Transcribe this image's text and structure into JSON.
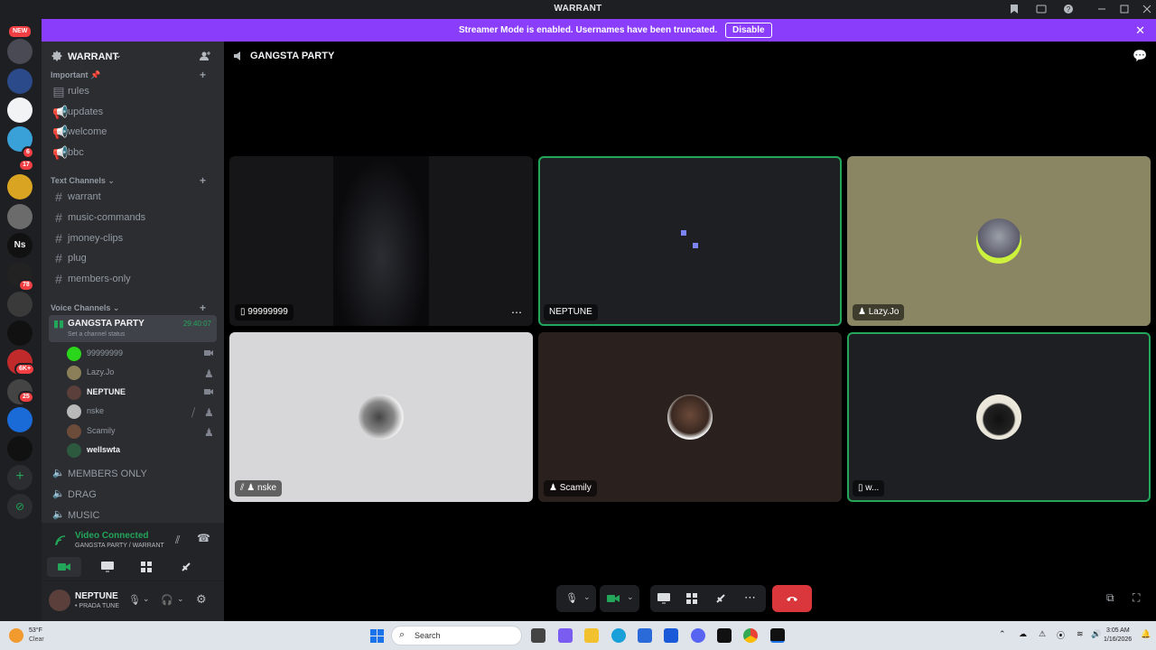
{
  "window": {
    "title": "WARRANT"
  },
  "banner": {
    "message": "Streamer Mode is enabled. Usernames have been truncated.",
    "button": "Disable"
  },
  "rail": {
    "new_badge": "NEW",
    "badges": [
      "6",
      "17",
      "78",
      "6K+",
      "25"
    ],
    "ns_label": "Ns"
  },
  "server": {
    "name": "WARRANT"
  },
  "sidebar": {
    "categories": {
      "important": "Important",
      "text": "Text Channels",
      "voice": "Voice Channels"
    },
    "announcements": [
      {
        "label": "rules"
      },
      {
        "label": "updates"
      },
      {
        "label": "welcome"
      },
      {
        "label": "bbc"
      }
    ],
    "text_channels": [
      {
        "label": "warrant"
      },
      {
        "label": "music-commands"
      },
      {
        "label": "jmoney-clips"
      },
      {
        "label": "plug"
      },
      {
        "label": "members-only"
      }
    ],
    "voice_channel": {
      "label": "GANGSTA PARTY",
      "timer": "29:40:07",
      "status": "Set a channel status"
    },
    "voice_users": [
      {
        "name": "99999999",
        "icon": "camera-icon",
        "color": "#2bd61a"
      },
      {
        "name": "Lazy.Jo",
        "icon": "playstation-icon",
        "color": "#8a7f58"
      },
      {
        "name": "NEPTUNE",
        "icon": "camera-icon",
        "color": "#5a3f3a"
      },
      {
        "name": "nske",
        "icon": "playstation-icon",
        "color": "#b9b9b9"
      },
      {
        "name": "Scamily",
        "icon": "playstation-icon",
        "color": "#6b4b3a"
      },
      {
        "name": "wellswta",
        "icon": "",
        "color": "#2d5a3f"
      }
    ],
    "more_voice": [
      {
        "label": "MEMBERS ONLY"
      },
      {
        "label": "DRAG"
      },
      {
        "label": "MUSIC"
      }
    ]
  },
  "voice_panel": {
    "status": "Video Connected",
    "location": "GANGSTA PARTY / WARRANT"
  },
  "user_panel": {
    "name": "NEPTUNE",
    "status": "• PRADA TUNE"
  },
  "call": {
    "channel": "GANGSTA PARTY"
  },
  "tiles": [
    {
      "name": "99999999",
      "prefix": "mobile-icon"
    },
    {
      "name": "NEPTUNE",
      "prefix": ""
    },
    {
      "name": "Lazy.Jo",
      "prefix": "playstation-icon"
    },
    {
      "name": "nske",
      "prefix": "deafened-playstation-icon"
    },
    {
      "name": "Scamily",
      "prefix": "playstation-icon"
    },
    {
      "name": "w...",
      "prefix": "mobile-icon"
    }
  ],
  "taskbar": {
    "temp": "53°F",
    "condition": "Clear",
    "search_placeholder": "Search",
    "time": "3:05 AM",
    "date": "1/16/2026"
  },
  "colors": {
    "accent": "#8b3dfc",
    "speaking": "#23a55a",
    "hangup": "#da373c"
  }
}
